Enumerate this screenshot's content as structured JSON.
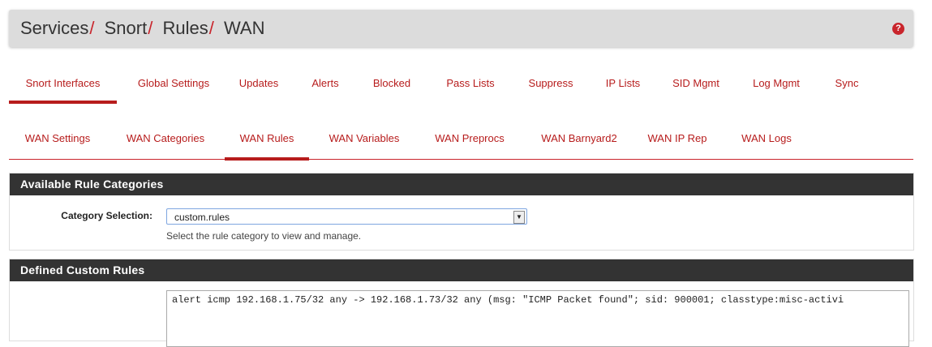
{
  "breadcrumb": {
    "items": [
      "Services",
      "Snort",
      "Rules",
      "WAN"
    ],
    "separator": "/"
  },
  "help_icon": {
    "glyph": "?",
    "icon": "question-circle-icon"
  },
  "nav_tabs": [
    {
      "label": "Snort Interfaces",
      "active": true
    },
    {
      "label": "Global Settings"
    },
    {
      "label": "Updates"
    },
    {
      "label": "Alerts"
    },
    {
      "label": "Blocked"
    },
    {
      "label": "Pass Lists"
    },
    {
      "label": "Suppress"
    },
    {
      "label": "IP Lists"
    },
    {
      "label": "SID Mgmt"
    },
    {
      "label": "Log Mgmt"
    },
    {
      "label": "Sync"
    }
  ],
  "interface_tabs": [
    {
      "label": "WAN Settings"
    },
    {
      "label": "WAN Categories"
    },
    {
      "label": "WAN Rules",
      "active": true
    },
    {
      "label": "WAN Variables"
    },
    {
      "label": "WAN Preprocs"
    },
    {
      "label": "WAN Barnyard2"
    },
    {
      "label": "WAN IP Rep"
    },
    {
      "label": "WAN Logs"
    }
  ],
  "categories_panel": {
    "title": "Available Rule Categories",
    "label": "Category Selection:",
    "selected": "custom.rules",
    "help": "Select the rule category to view and manage.",
    "arrow_glyph": "▼"
  },
  "custom_rules_panel": {
    "title": "Defined Custom Rules",
    "content": "alert icmp 192.168.1.75/32 any -> 192.168.1.73/32 any (msg: \"ICMP Packet found\"; sid: 900001; classtype:misc-activi"
  },
  "colors": {
    "accent": "#b71c1c",
    "panel_heading": "#333333",
    "header_bg": "#dcdcdc"
  }
}
